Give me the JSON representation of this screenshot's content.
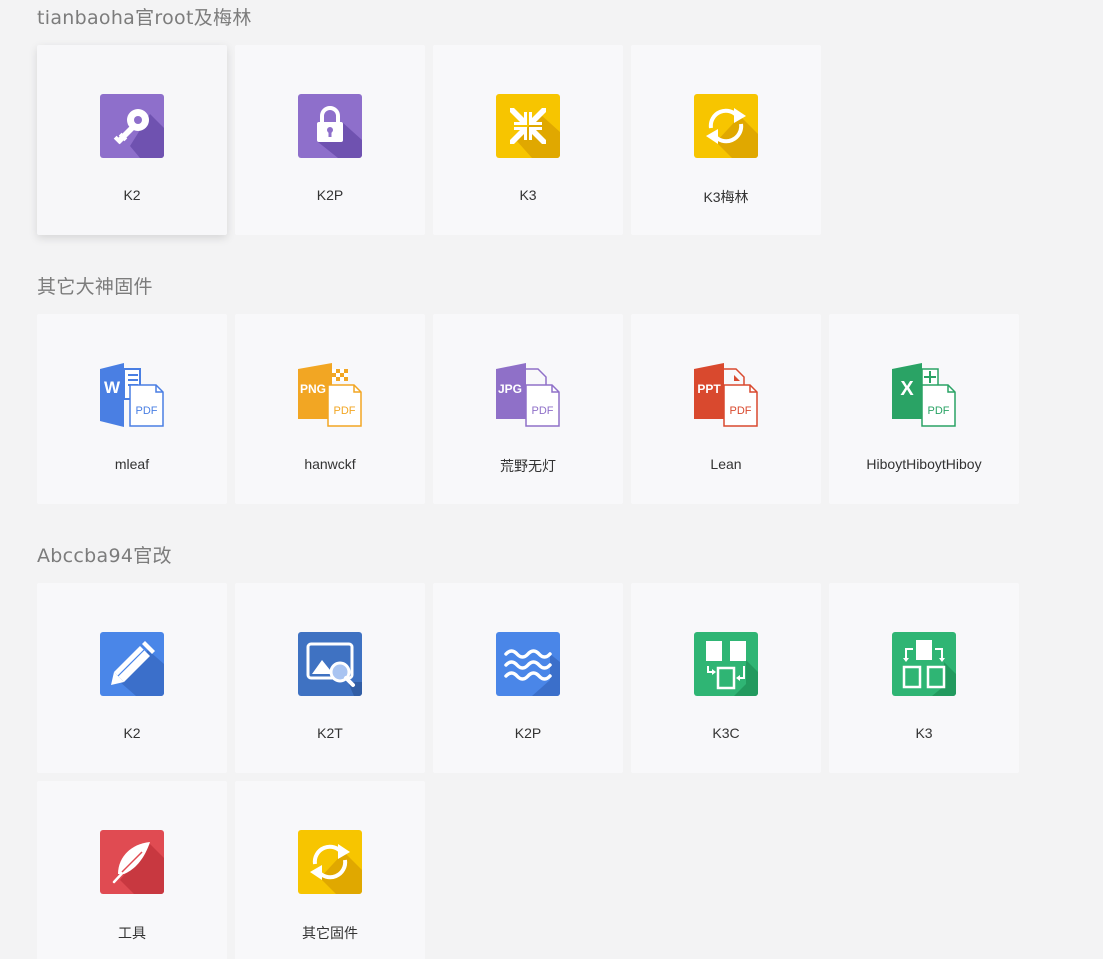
{
  "colors": {
    "purple": "#8e6fcb",
    "yellow": "#f7c500",
    "blue": "#4a86e8",
    "green": "#2fb574",
    "red": "#e04b52",
    "word_blue": "#4a7fe3",
    "png_orange": "#f2a623",
    "jpg_purple": "#8f70c8",
    "ppt_red": "#d9492e",
    "excel_green": "#2aa365"
  },
  "sections": [
    {
      "title": "tianbaoha官root及梅林",
      "tiles": [
        {
          "label": "K2",
          "icon": "key-icon"
        },
        {
          "label": "K2P",
          "icon": "lock-icon"
        },
        {
          "label": "K3",
          "icon": "compress-arrows-icon"
        },
        {
          "label": "K3梅林",
          "icon": "sync-icon"
        }
      ]
    },
    {
      "title": "其它大神固件",
      "tiles": [
        {
          "label": "mleaf",
          "icon": "word-to-pdf-icon",
          "badge": "W",
          "pdf_text": "PDF"
        },
        {
          "label": "hanwckf",
          "icon": "png-to-pdf-icon",
          "badge": "PNG",
          "pdf_text": "PDF"
        },
        {
          "label": "荒野无灯",
          "icon": "jpg-to-pdf-icon",
          "badge": "JPG",
          "pdf_text": "PDF"
        },
        {
          "label": "Lean",
          "icon": "ppt-to-pdf-icon",
          "badge": "PPT",
          "pdf_text": "PDF"
        },
        {
          "label": "HiboytHiboytHiboy",
          "icon": "excel-to-pdf-icon",
          "badge": "X",
          "pdf_text": "PDF"
        }
      ]
    },
    {
      "title": "Abccba94官改",
      "tiles": [
        {
          "label": "K2",
          "icon": "pencil-icon"
        },
        {
          "label": "K2T",
          "icon": "image-search-icon"
        },
        {
          "label": "K2P",
          "icon": "waves-icon"
        },
        {
          "label": "K3C",
          "icon": "split-pages-icon"
        },
        {
          "label": "K3",
          "icon": "merge-pages-icon"
        },
        {
          "label": "工具",
          "icon": "feather-icon"
        },
        {
          "label": "其它固件",
          "icon": "sync-icon"
        }
      ]
    }
  ]
}
